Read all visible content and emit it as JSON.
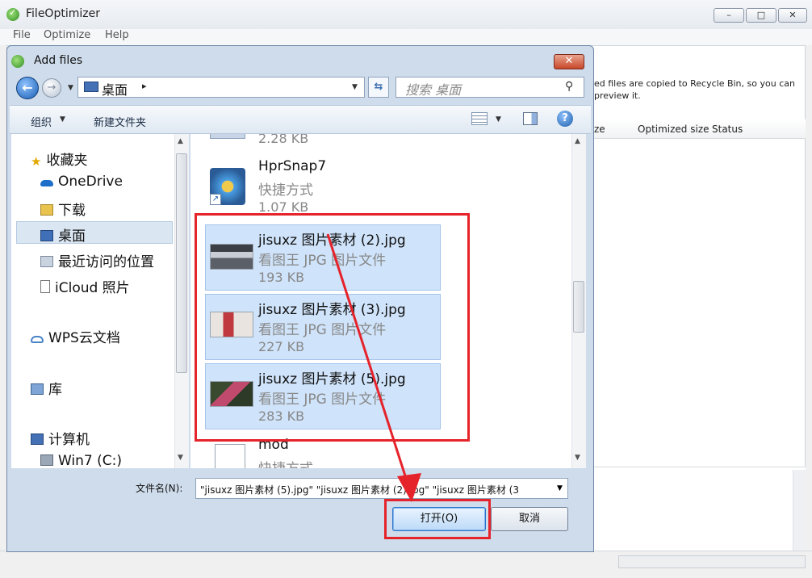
{
  "main_window": {
    "title": "FileOptimizer",
    "menu": [
      "File",
      "Optimize",
      "Help"
    ],
    "info_line1": "ed files are copied to Recycle Bin, so you can",
    "info_line2": "preview it.",
    "columns": [
      "ze",
      "Optimized size",
      "Status"
    ],
    "controls": {
      "minimize": "–",
      "maximize": "□",
      "close": "✕"
    }
  },
  "dialog": {
    "title": "Add files",
    "address": "桌面",
    "address_sep": "▸",
    "search_placeholder": "搜索 桌面",
    "toolbar": {
      "organize": "组织",
      "new_folder": "新建文件夹"
    },
    "nav": {
      "favorites": "收藏夹",
      "onedrive": "OneDrive",
      "downloads": "下载",
      "desktop": "桌面",
      "recent": "最近访问的位置",
      "icloud": "iCloud 照片",
      "wps": "WPS云文档",
      "libraries": "库",
      "computer": "计算机",
      "drive_c": "Win7 (C:)"
    },
    "files": [
      {
        "name": "",
        "type": "",
        "size": "2.28 KB"
      },
      {
        "name": "HprSnap7",
        "type": "快捷方式",
        "size": "1.07 KB"
      },
      {
        "name": "jisuxz 图片素材 (2).jpg",
        "type": "看图王 JPG 图片文件",
        "size": "193 KB"
      },
      {
        "name": "jisuxz 图片素材 (3).jpg",
        "type": "看图王 JPG 图片文件",
        "size": "227 KB"
      },
      {
        "name": "jisuxz 图片素材 (5).jpg",
        "type": "看图王 JPG 图片文件",
        "size": "283 KB"
      },
      {
        "name": "mod",
        "type": "快捷方式",
        "size": ""
      }
    ],
    "filename_label": "文件名(N):",
    "filename_value": "\"jisuxz 图片素材 (5).jpg\" \"jisuxz 图片素材 (2).jpg\" \"jisuxz 图片素材 (3",
    "open_button": "打开(O)",
    "cancel_button": "取消"
  },
  "colors": {
    "highlight": "#e5232b",
    "selection": "#cfe3fa",
    "accent": "#2c73c8"
  }
}
